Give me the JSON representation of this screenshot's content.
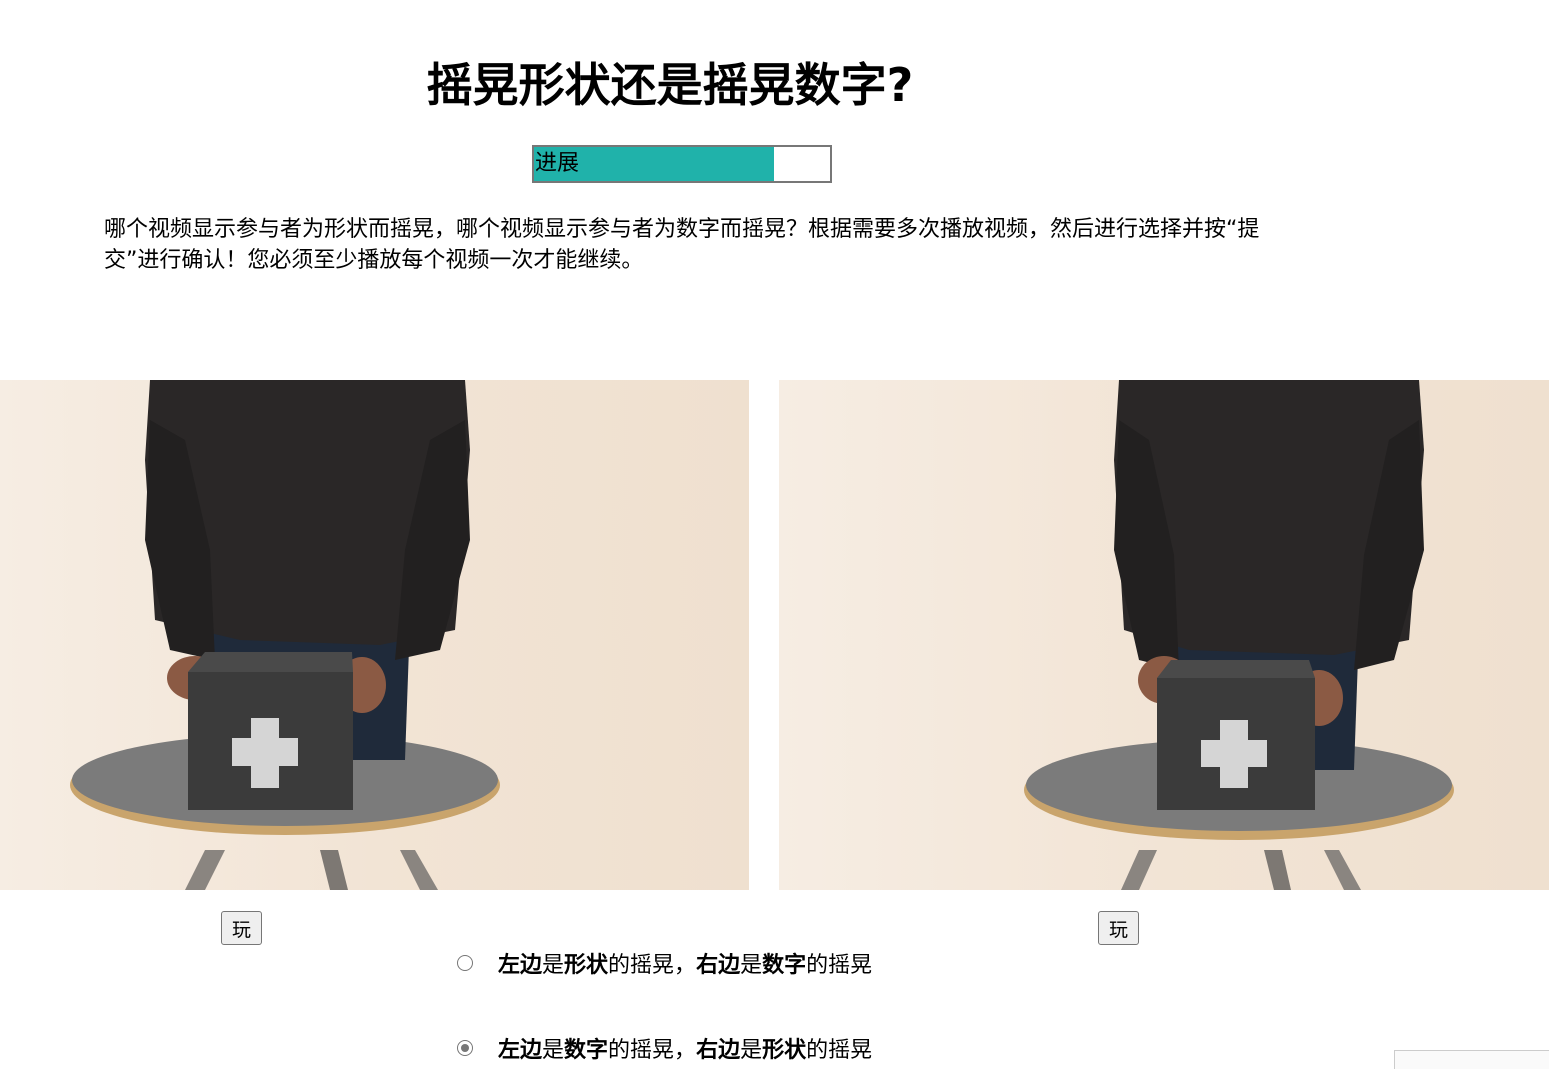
{
  "title": "摇晃形状还是摇晃数字?",
  "progress": {
    "label": "进展",
    "fraction": 0.81,
    "fill_color": "#20b2aa"
  },
  "instructions": "哪个视频显示参与者为形状而摇晃，哪个视频显示参与者为数字而摇晃？根据需要多次播放视频，然后进行选择并按“提交”进行确认！您必须至少播放每个视频一次才能继续。",
  "videos": {
    "left": {
      "play_label": "玩"
    },
    "right": {
      "play_label": "玩"
    }
  },
  "options": [
    {
      "selected": false,
      "parts": {
        "l1": "左边",
        "t1": "是",
        "b1": "形状",
        "t2": "的摇晃，",
        "l2": "右边",
        "t3": "是",
        "b2": "数字",
        "t4": "的摇晃"
      }
    },
    {
      "selected": true,
      "parts": {
        "l1": "左边",
        "t1": "是",
        "b1": "数字",
        "t2": "的摇晃，",
        "l2": "右边",
        "t3": "是",
        "b2": "形状",
        "t4": "的摇晃"
      }
    }
  ]
}
